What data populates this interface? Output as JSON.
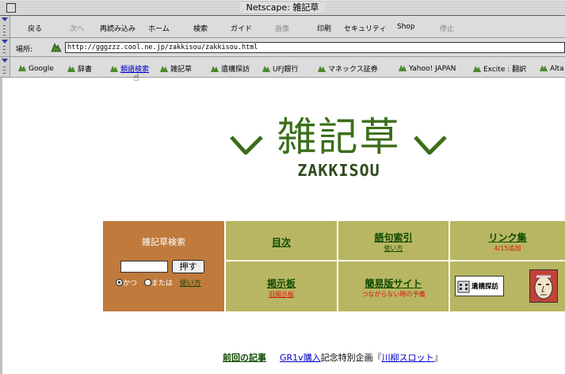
{
  "window": {
    "title": "Netscape: 雑記草"
  },
  "toolbar": {
    "back": "戻る",
    "forward": "次へ",
    "reload": "再読み込み",
    "home": "ホーム",
    "search": "検索",
    "guide": "ガイド",
    "images": "画像",
    "print": "印刷",
    "security": "セキュリティ",
    "shop": "Shop",
    "stop": "停止"
  },
  "location": {
    "label": "場所:",
    "url": "http://gggzzz.cool.ne.jp/zakkisou/zakkisou.html"
  },
  "bookmarks": {
    "items": [
      {
        "label": "Google"
      },
      {
        "label": "辞書"
      },
      {
        "label": "類語検索"
      },
      {
        "label": "雑記草"
      },
      {
        "label": "遺構探訪"
      },
      {
        "label": "UFJ銀行"
      },
      {
        "label": "マネックス証券"
      },
      {
        "label": "Yahoo! JAPAN"
      },
      {
        "label": "Excite : 翻訳"
      },
      {
        "label": "Alta"
      }
    ]
  },
  "logo": {
    "kanji": "雑記草",
    "latin": "ZAKKISOU"
  },
  "search_panel": {
    "title": "雑記草検索",
    "button": "押す",
    "input_value": "",
    "and_label": "かつ",
    "or_label": "または",
    "howto": "使い方"
  },
  "nav": {
    "toc": "目次",
    "index": "語句索引",
    "index_sub": "使い方",
    "links": "リンク集",
    "links_sub": "4/15追加",
    "bbs": "掲示板",
    "bbs_sub": "旧掲示板",
    "lite": "簡易版サイト",
    "lite_sub": "つながらない時の予備",
    "iko_banner": "遺構探訪"
  },
  "footer": {
    "prev": "前回の記事",
    "gr1v": "GR1v",
    "buy": "購入",
    "mid": "記念特別企画『",
    "senryu": "川柳スロット",
    "end": "』"
  },
  "colors": {
    "olive": "#b8b662",
    "rust": "#bf7a3c",
    "link_green": "#0d4a00",
    "logo_green": "#3b6e1a"
  }
}
